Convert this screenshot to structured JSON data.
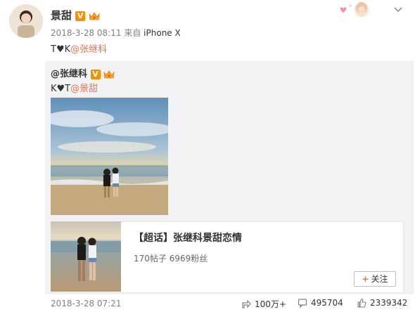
{
  "post": {
    "author": "景甜",
    "verified_badge": "V",
    "time": "2018-3-28 08:11",
    "source_prefix": "来自",
    "device": "iPhone X",
    "text_prefix": "T♥K",
    "mention": "@张继科"
  },
  "repost": {
    "author": "@张继科",
    "verified_badge": "V",
    "text_prefix": "K♥T",
    "mention": "@景甜",
    "card": {
      "title": "【超话】张继科景甜恋情",
      "stats": "170帖子 6969粉丝",
      "follow_label": "关注",
      "follow_plus": "+"
    },
    "time": "2018-3-28 07:21",
    "shares": "100万+",
    "comments": "495704",
    "likes": "2339342"
  },
  "colors": {
    "link": "#eb7350",
    "badge": "#f29100",
    "repost_bg": "#f2f2f5"
  }
}
